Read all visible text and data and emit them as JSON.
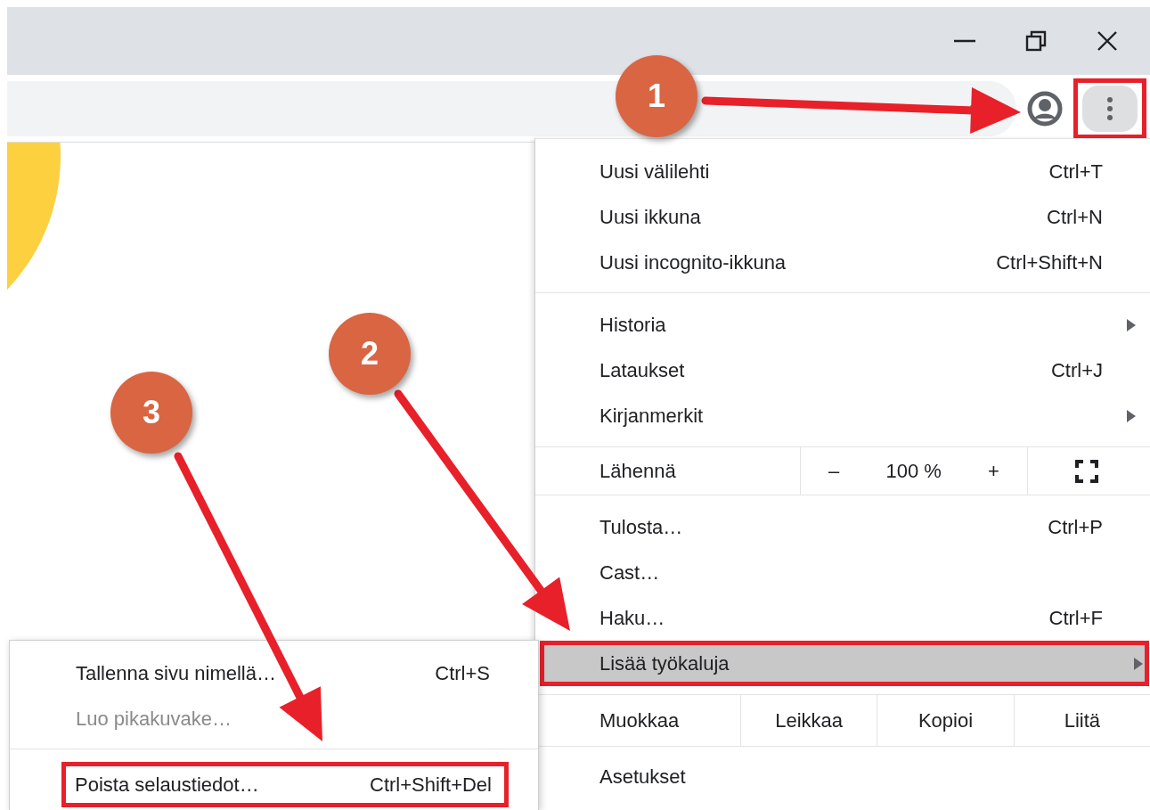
{
  "toolbar": {
    "menu_button": {
      "marked": true
    }
  },
  "menu": {
    "sections": [
      {
        "kind": "items",
        "items": [
          {
            "label": "Uusi välilehti",
            "shortcut": "Ctrl+T",
            "submenu": false,
            "selected": false,
            "marked": false
          },
          {
            "label": "Uusi ikkuna",
            "shortcut": "Ctrl+N",
            "submenu": false,
            "selected": false,
            "marked": false
          },
          {
            "label": "Uusi incognito-ikkuna",
            "shortcut": "Ctrl+Shift+N",
            "submenu": false,
            "selected": false,
            "marked": false
          }
        ]
      },
      {
        "kind": "items",
        "items": [
          {
            "label": "Historia",
            "submenu": true,
            "selected": false,
            "marked": false
          },
          {
            "label": "Lataukset",
            "shortcut": "Ctrl+J",
            "submenu": false,
            "selected": false,
            "marked": false
          },
          {
            "label": "Kirjanmerkit",
            "submenu": true,
            "selected": false,
            "marked": false
          }
        ]
      },
      {
        "kind": "zoom",
        "label": "Lähennä",
        "decrease": "–",
        "value": "100 %",
        "increase": "+"
      },
      {
        "kind": "items",
        "items": [
          {
            "label": "Tulosta…",
            "shortcut": "Ctrl+P",
            "submenu": false,
            "selected": false,
            "marked": false
          },
          {
            "label": "Cast…",
            "submenu": false,
            "selected": false,
            "marked": false
          },
          {
            "label": "Haku…",
            "shortcut": "Ctrl+F",
            "submenu": false,
            "selected": false,
            "marked": false
          },
          {
            "label": "Lisää työkaluja",
            "submenu": true,
            "selected": true,
            "marked": true
          }
        ]
      },
      {
        "kind": "edit",
        "label": "Muokkaa",
        "actions": [
          "Leikkaa",
          "Kopioi",
          "Liitä"
        ]
      },
      {
        "kind": "items",
        "items": [
          {
            "label": "Asetukset",
            "submenu": false,
            "selected": false,
            "marked": false
          }
        ]
      }
    ]
  },
  "submenu": {
    "sections": [
      {
        "kind": "items",
        "items": [
          {
            "label": "Tallenna sivu nimellä…",
            "shortcut": "Ctrl+S",
            "disabled": false,
            "marked": false
          },
          {
            "label": "Luo pikakuvake…",
            "disabled": true,
            "marked": false
          }
        ]
      },
      {
        "kind": "items",
        "items": [
          {
            "label": "Poista selaustiedot…",
            "shortcut": "Ctrl+Shift+Del",
            "disabled": false,
            "marked": true
          }
        ]
      }
    ]
  },
  "callouts": [
    {
      "number": "1"
    },
    {
      "number": "2"
    },
    {
      "number": "3"
    }
  ]
}
